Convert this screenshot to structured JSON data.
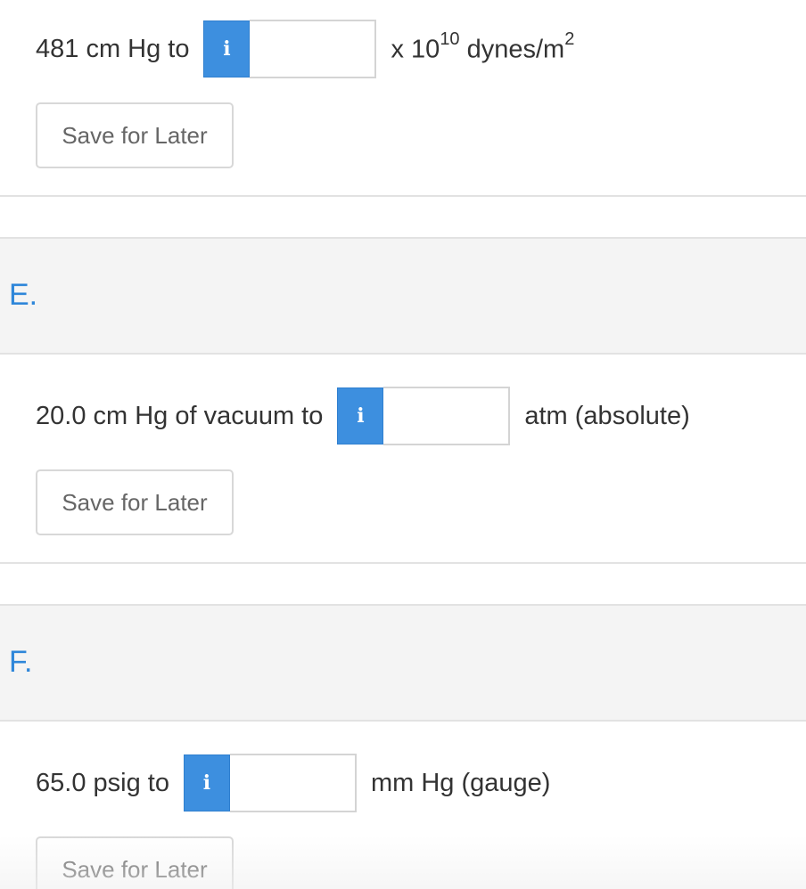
{
  "questions": [
    {
      "prompt": "481 cm Hg to",
      "info_icon": "i",
      "answer_value": "",
      "unit_prefix": "x 10",
      "unit_exp": "10",
      "unit_mid": " dynes/m",
      "unit_exp2": "2",
      "save_label": "Save for Later"
    },
    {
      "part_label": "E.",
      "prompt": "20.0 cm Hg of vacuum to",
      "info_icon": "i",
      "answer_value": "",
      "unit": "atm (absolute)",
      "save_label": "Save for Later"
    },
    {
      "part_label": "F.",
      "prompt": "65.0 psig to",
      "info_icon": "i",
      "answer_value": "",
      "unit": "mm Hg (gauge)",
      "save_label": "Save for Later"
    }
  ],
  "colors": {
    "accent": "#3d8fdf",
    "part_label": "#2e86d9",
    "header_bg": "#f4f4f4",
    "border": "#e2e2e2"
  }
}
